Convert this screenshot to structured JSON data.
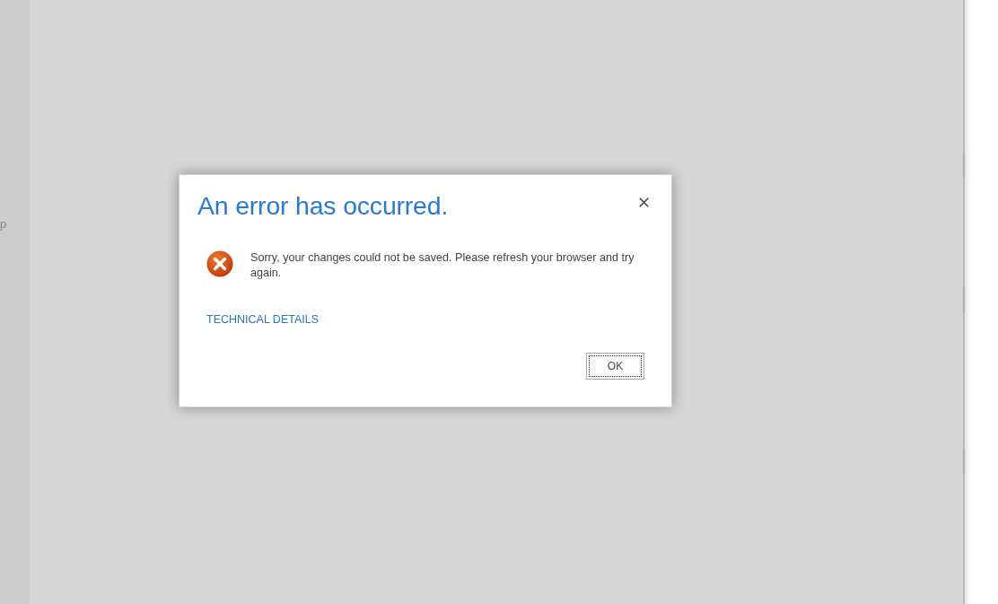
{
  "sidebar": {
    "text_fragment": "p"
  },
  "dialog": {
    "title": "An error has occurred.",
    "message": "Sorry, your changes could not be saved. Please refresh your browser and try again.",
    "link": "TECHNICAL DETAILS",
    "buttons": [
      {
        "label": "OK",
        "focused": true
      }
    ]
  }
}
